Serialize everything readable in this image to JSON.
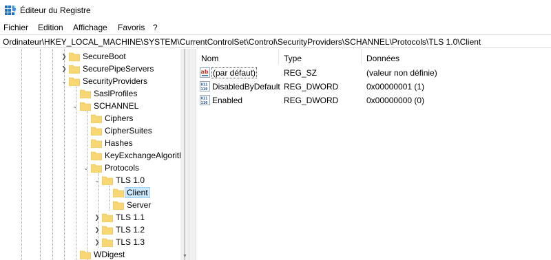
{
  "window": {
    "title": "Éditeur du Registre"
  },
  "menu": [
    "Fichier",
    "Edition",
    "Affichage",
    "Favoris",
    "?"
  ],
  "address": "Ordinateur\\HKEY_LOCAL_MACHINE\\SYSTEM\\CurrentControlSet\\Control\\SecurityProviders\\SCHANNEL\\Protocols\\TLS 1.0\\Client",
  "tree": [
    {
      "label": "SecureBoot",
      "expander": "collapsed"
    },
    {
      "label": "SecurePipeServers",
      "expander": "collapsed"
    },
    {
      "label": "SecurityProviders",
      "expander": "expanded"
    },
    {
      "label": "SaslProfiles",
      "expander": "none"
    },
    {
      "label": "SCHANNEL",
      "expander": "expanded"
    },
    {
      "label": "Ciphers",
      "expander": "none"
    },
    {
      "label": "CipherSuites",
      "expander": "none"
    },
    {
      "label": "Hashes",
      "expander": "none"
    },
    {
      "label": "KeyExchangeAlgoritl",
      "expander": "none"
    },
    {
      "label": "Protocols",
      "expander": "expanded"
    },
    {
      "label": "TLS 1.0",
      "expander": "expanded"
    },
    {
      "label": "Client",
      "expander": "none",
      "selected": true
    },
    {
      "label": "Server",
      "expander": "none"
    },
    {
      "label": "TLS 1.1",
      "expander": "collapsed"
    },
    {
      "label": "TLS 1.2",
      "expander": "collapsed"
    },
    {
      "label": "TLS 1.3",
      "expander": "collapsed"
    },
    {
      "label": "WDigest",
      "expander": "none"
    }
  ],
  "list": {
    "headers": {
      "name": "Nom",
      "type": "Type",
      "data": "Données"
    },
    "rows": [
      {
        "icon": "string-value-icon",
        "name": "(par défaut)",
        "type": "REG_SZ",
        "data": "(valeur non définie)"
      },
      {
        "icon": "binary-value-icon",
        "name": "DisabledByDefault",
        "type": "REG_DWORD",
        "data": "0x00000001 (1)"
      },
      {
        "icon": "binary-value-icon",
        "name": "Enabled",
        "type": "REG_DWORD",
        "data": "0x00000000 (0)"
      }
    ]
  },
  "colors": {
    "selection_bg": "#cce8ff",
    "selection_border": "#99d1ff",
    "folder": "#f8d775",
    "app_icon": "#1f6fc5"
  }
}
